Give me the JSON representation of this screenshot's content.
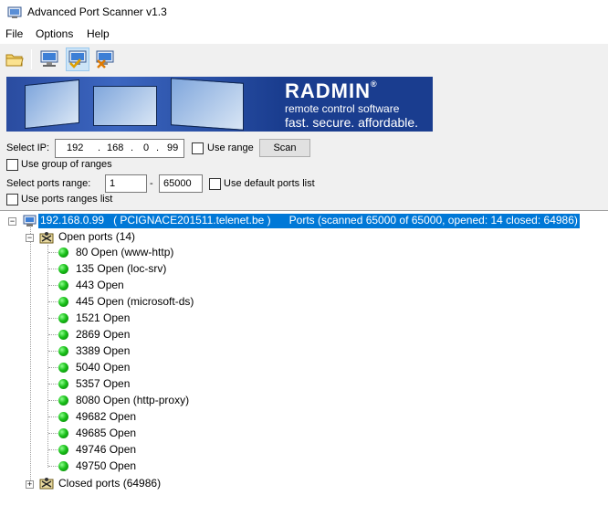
{
  "window": {
    "title": "Advanced Port Scanner v1.3"
  },
  "menu": {
    "file": "File",
    "options": "Options",
    "help": "Help"
  },
  "banner": {
    "brand": "RADMIN",
    "reg": "®",
    "subtitle": "remote control software",
    "tagline": "fast. secure. affordable."
  },
  "form": {
    "select_ip_label": "Select IP:",
    "ip_octets": [
      "192",
      "168",
      "0",
      "99"
    ],
    "use_range_label": "Use range",
    "scan_label": "Scan",
    "use_group_label": "Use group of ranges",
    "ports_range_label": "Select ports range:",
    "port_from": "1",
    "port_sep": "-",
    "port_to": "65000",
    "use_default_ports_label": "Use default ports list",
    "use_ports_ranges_label": "Use ports ranges list"
  },
  "tree": {
    "host_ip": "192.168.0.99",
    "host_name": "( PCIGNACE201511.telenet.be )",
    "host_ports": "Ports (scanned 65000 of 65000, opened: 14 closed: 64986)",
    "open_ports_label": "Open ports (14)",
    "closed_ports_label": "Closed ports (64986)",
    "open_ports": [
      "80 Open (www-http)",
      "135 Open (loc-srv)",
      "443 Open",
      "445 Open (microsoft-ds)",
      "1521 Open",
      "2869 Open",
      "3389 Open",
      "5040 Open",
      "5357 Open",
      "8080 Open (http-proxy)",
      "49682 Open",
      "49685 Open",
      "49746 Open",
      "49750 Open"
    ]
  }
}
